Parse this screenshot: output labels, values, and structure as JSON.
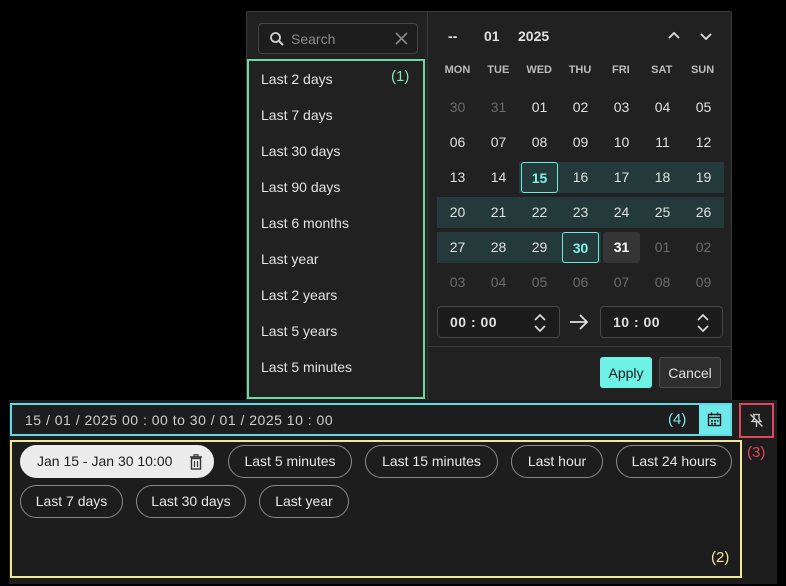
{
  "search": {
    "placeholder": "Search"
  },
  "quick_ranges": [
    "Last 2 days",
    "Last 7 days",
    "Last 30 days",
    "Last 90 days",
    "Last 6 months",
    "Last year",
    "Last 2 years",
    "Last 5 years",
    "Last 5 minutes",
    "Last 15 minutes"
  ],
  "annotations": {
    "one": "(1)",
    "two": "(2)",
    "three": "(3)",
    "four": "(4)"
  },
  "calendar": {
    "day_placeholder": "--",
    "month": "01",
    "year": "2025",
    "weekdays": [
      "MON",
      "TUE",
      "WED",
      "THU",
      "FRI",
      "SAT",
      "SUN"
    ],
    "weeks": [
      [
        "30",
        "31",
        "01",
        "02",
        "03",
        "04",
        "05"
      ],
      [
        "06",
        "07",
        "08",
        "09",
        "10",
        "11",
        "12"
      ],
      [
        "13",
        "14",
        "15",
        "16",
        "17",
        "18",
        "19"
      ],
      [
        "20",
        "21",
        "22",
        "23",
        "24",
        "25",
        "26"
      ],
      [
        "27",
        "28",
        "29",
        "30",
        "31",
        "01",
        "02"
      ],
      [
        "03",
        "04",
        "05",
        "06",
        "07",
        "08",
        "09"
      ]
    ],
    "start_time": "00 : 00",
    "end_time": "10 : 00",
    "apply_label": "Apply",
    "cancel_label": "Cancel"
  },
  "range_input": {
    "value": "15 / 01 / 2025  00 : 00  to  30 / 01 / 2025  10 : 00"
  },
  "chips": {
    "active": "Jan 15 - Jan 30 10:00",
    "items": [
      "Last 5 minutes",
      "Last 15 minutes",
      "Last hour",
      "Last 24 hours",
      "Last 7 days",
      "Last 30 days",
      "Last year"
    ]
  },
  "colors": {
    "accent": "#6ef2e6",
    "annotation_green": "#6fd7a6",
    "annotation_yellow": "#f5e69a",
    "annotation_red": "#e0455c",
    "annotation_cyan": "#63d8e6"
  }
}
